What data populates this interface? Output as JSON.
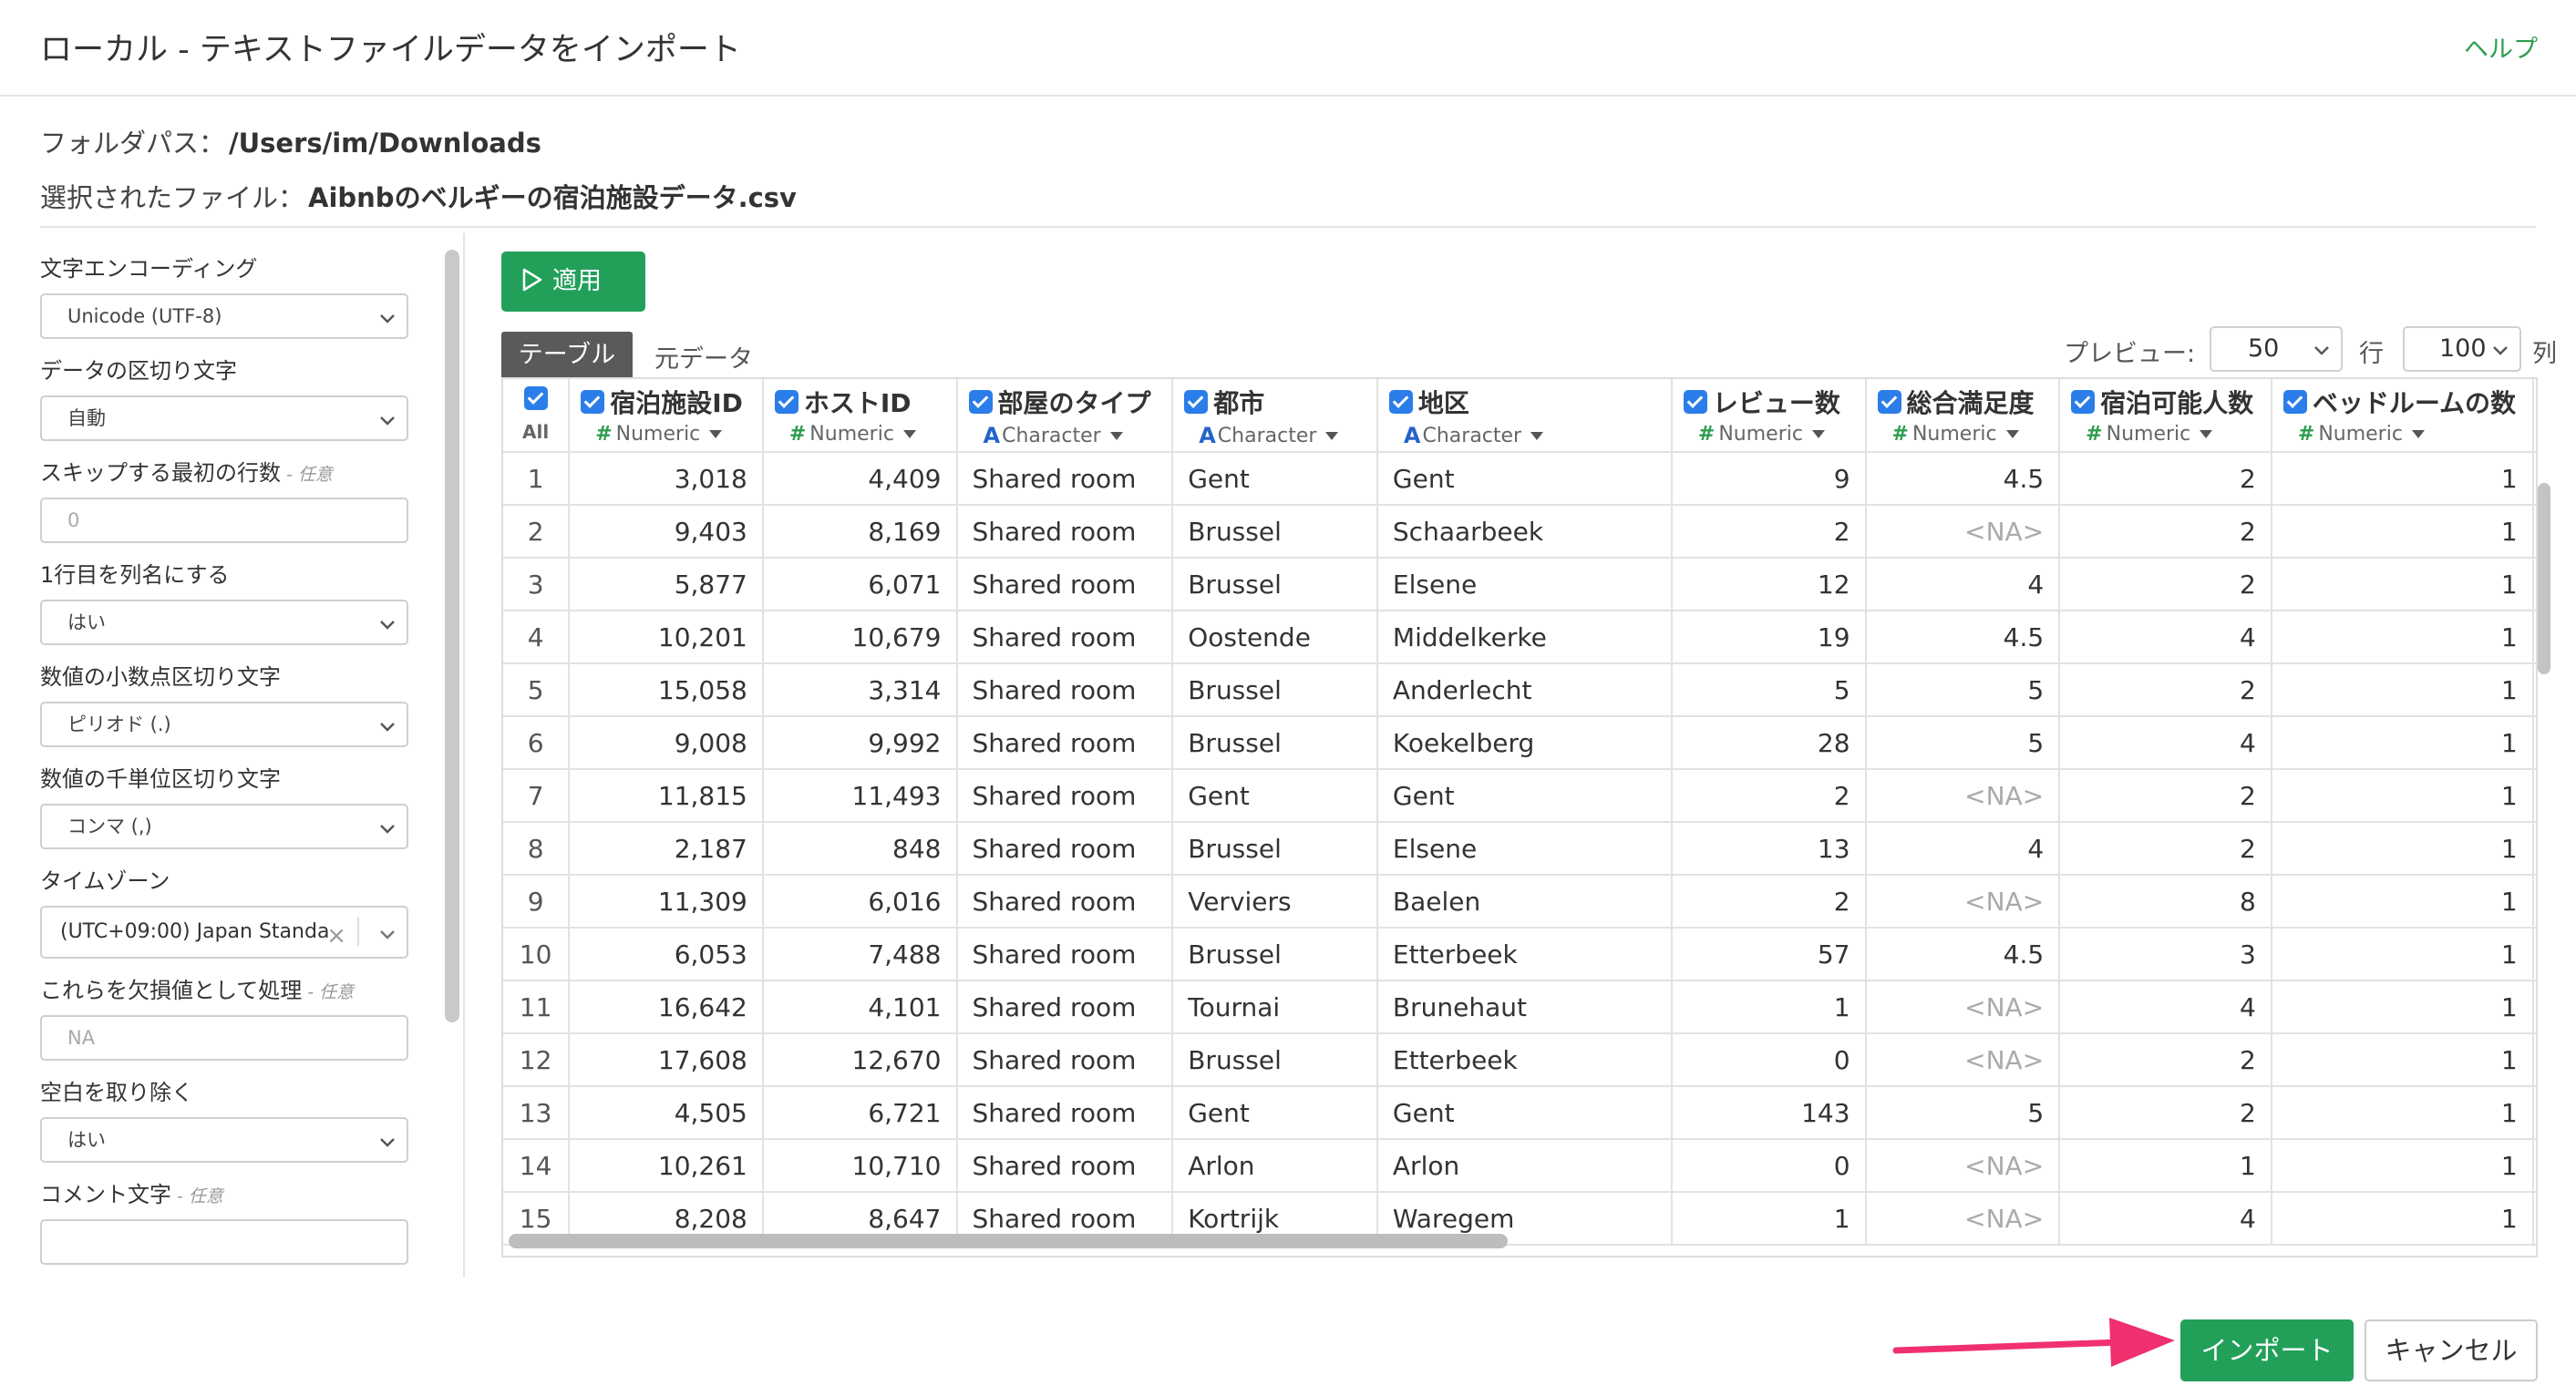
{
  "dialog": {
    "title": "ローカル - テキストファイルデータをインポート",
    "help_link": "ヘルプ",
    "folder_label": "フォルダパス：",
    "folder_path": "/Users/im/Downloads",
    "file_label": "選択されたファイル：",
    "file_name": "Aibnbのベルギーの宿泊施設データ.csv"
  },
  "settings": {
    "encoding": {
      "label": "文字エンコーディング",
      "value": "Unicode (UTF-8)"
    },
    "delimiter": {
      "label": "データの区切り文字",
      "value": "自動"
    },
    "skip_rows": {
      "label": "スキップする最初の行数",
      "optional": "- 任意",
      "value": "0"
    },
    "header_row": {
      "label": "1行目を列名にする",
      "value": "はい"
    },
    "decimal_mark": {
      "label": "数値の小数点区切り文字",
      "value": "ピリオド (.)"
    },
    "grouping_mark": {
      "label": "数値の千単位区切り文字",
      "value": "コンマ (,)"
    },
    "timezone": {
      "label": "タイムゾーン",
      "value": "(UTC+09:00) Japan Standa"
    },
    "na_values": {
      "label": "これらを欠損値として処理",
      "optional": "- 任意",
      "placeholder": "NA"
    },
    "trim": {
      "label": "空白を取り除く",
      "value": "はい"
    },
    "comment": {
      "label": "コメント文字",
      "optional": "- 任意",
      "value": ""
    }
  },
  "toolbar": {
    "apply_label": "適用",
    "tab_table": "テーブル",
    "tab_raw": "元データ",
    "preview_label": "プレビュー:",
    "preview_rows": "50",
    "row_unit": "行",
    "preview_cols": "100",
    "col_unit": "列"
  },
  "table": {
    "all_label": "All",
    "columns": [
      {
        "name": "宿泊施設ID",
        "type": "Numeric",
        "kind": "num"
      },
      {
        "name": "ホストID",
        "type": "Numeric",
        "kind": "num"
      },
      {
        "name": "部屋のタイプ",
        "type": "Character",
        "kind": "chr"
      },
      {
        "name": "都市",
        "type": "Character",
        "kind": "chr"
      },
      {
        "name": "地区",
        "type": "Character",
        "kind": "chr"
      },
      {
        "name": "レビュー数",
        "type": "Numeric",
        "kind": "num"
      },
      {
        "name": "総合満足度",
        "type": "Numeric",
        "kind": "num"
      },
      {
        "name": "宿泊可能人数",
        "type": "Numeric",
        "kind": "num"
      },
      {
        "name": "ベッドルームの数",
        "type": "Numeric",
        "kind": "num"
      }
    ],
    "rows": [
      [
        "1",
        "3,018",
        "4,409",
        "Shared room",
        "Gent",
        "Gent",
        "9",
        "4.5",
        "2",
        "1"
      ],
      [
        "2",
        "9,403",
        "8,169",
        "Shared room",
        "Brussel",
        "Schaarbeek",
        "2",
        "<NA>",
        "2",
        "1"
      ],
      [
        "3",
        "5,877",
        "6,071",
        "Shared room",
        "Brussel",
        "Elsene",
        "12",
        "4",
        "2",
        "1"
      ],
      [
        "4",
        "10,201",
        "10,679",
        "Shared room",
        "Oostende",
        "Middelkerke",
        "19",
        "4.5",
        "4",
        "1"
      ],
      [
        "5",
        "15,058",
        "3,314",
        "Shared room",
        "Brussel",
        "Anderlecht",
        "5",
        "5",
        "2",
        "1"
      ],
      [
        "6",
        "9,008",
        "9,992",
        "Shared room",
        "Brussel",
        "Koekelberg",
        "28",
        "5",
        "4",
        "1"
      ],
      [
        "7",
        "11,815",
        "11,493",
        "Shared room",
        "Gent",
        "Gent",
        "2",
        "<NA>",
        "2",
        "1"
      ],
      [
        "8",
        "2,187",
        "848",
        "Shared room",
        "Brussel",
        "Elsene",
        "13",
        "4",
        "2",
        "1"
      ],
      [
        "9",
        "11,309",
        "6,016",
        "Shared room",
        "Verviers",
        "Baelen",
        "2",
        "<NA>",
        "8",
        "1"
      ],
      [
        "10",
        "6,053",
        "7,488",
        "Shared room",
        "Brussel",
        "Etterbeek",
        "57",
        "4.5",
        "3",
        "1"
      ],
      [
        "11",
        "16,642",
        "4,101",
        "Shared room",
        "Tournai",
        "Brunehaut",
        "1",
        "<NA>",
        "4",
        "1"
      ],
      [
        "12",
        "17,608",
        "12,670",
        "Shared room",
        "Brussel",
        "Etterbeek",
        "0",
        "<NA>",
        "2",
        "1"
      ],
      [
        "13",
        "4,505",
        "6,721",
        "Shared room",
        "Gent",
        "Gent",
        "143",
        "5",
        "2",
        "1"
      ],
      [
        "14",
        "10,261",
        "10,710",
        "Shared room",
        "Arlon",
        "Arlon",
        "0",
        "<NA>",
        "1",
        "1"
      ],
      [
        "15",
        "8,208",
        "8,647",
        "Shared room",
        "Kortrijk",
        "Waregem",
        "1",
        "<NA>",
        "4",
        "1"
      ]
    ]
  },
  "footer": {
    "import_label": "インポート",
    "cancel_label": "キャンセル"
  },
  "colors": {
    "accent_green": "#22a05a",
    "checkbox_blue": "#2b7de9",
    "arrow_pink": "#f0306e"
  }
}
